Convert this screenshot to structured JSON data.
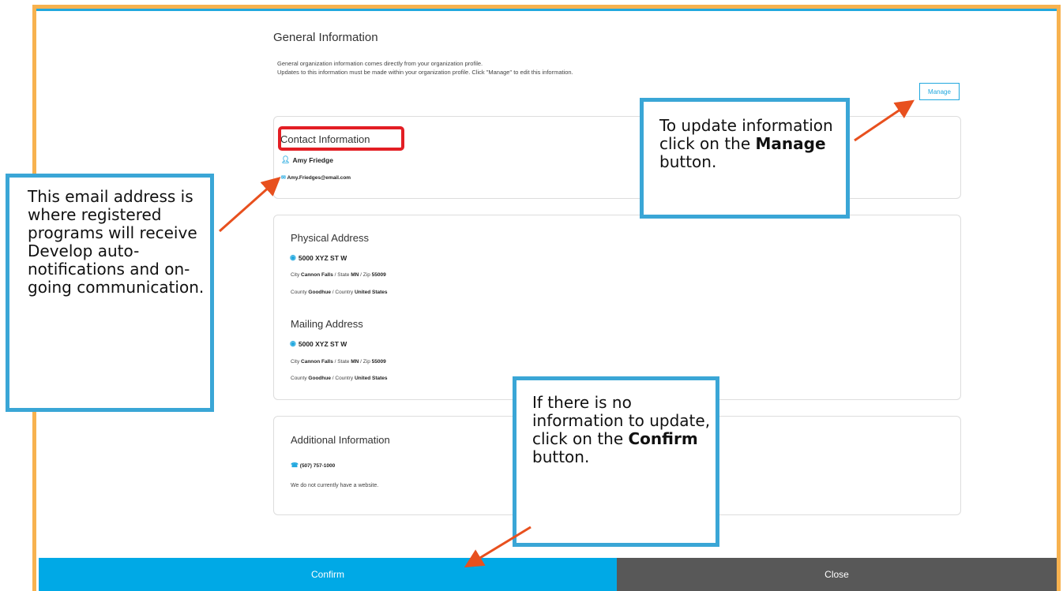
{
  "general": {
    "title": "General Information",
    "description_line1": "General organization information comes directly from your organization profile.",
    "description_line2": "Updates to this information must be made within your organization profile. Click \"Manage\" to edit this information.",
    "manage_label": "Manage"
  },
  "contact": {
    "heading": "Contact Information",
    "name": "Amy Friedge",
    "email": "Amy.Friedges@email.com",
    "icons": {
      "person": "person-icon",
      "email": "envelope-icon"
    }
  },
  "physical": {
    "heading": "Physical Address",
    "street": "5000 XYZ ST W",
    "city_label": "City",
    "city": "Cannon Falls",
    "state_label": "State",
    "state": "MN",
    "zip_label": "Zip",
    "zip": "55009",
    "county_label": "County",
    "county": "Goodhue",
    "country_label": "Country",
    "country": "United States"
  },
  "mailing": {
    "heading": "Mailing Address",
    "street": "5000 XYZ ST W",
    "city_label": "City",
    "city": "Cannon Falls",
    "state_label": "State",
    "state": "MN",
    "zip_label": "Zip",
    "zip": "55009",
    "county_label": "County",
    "county": "Goodhue",
    "country_label": "Country",
    "country": "United States"
  },
  "additional": {
    "heading": "Additional Information",
    "phone": "(507) 757-1000",
    "website_note": "We do not currently have a website."
  },
  "callouts": {
    "email_note": "This email address is where registered programs will receive Develop auto-notifications and on-going communication.",
    "manage_pre": "To update information click on the ",
    "manage_bold": "Manage",
    "manage_post": " button.",
    "confirm_pre": "If there is no information to update, click on the ",
    "confirm_bold": "Confirm",
    "confirm_post": " button."
  },
  "footer": {
    "confirm_label": "Confirm",
    "close_label": "Close"
  },
  "colors": {
    "frame": "#f7b24f",
    "accent": "#21a8df",
    "callout_border": "#3aa6d6",
    "highlight": "#e31e24",
    "arrow": "#e8501e",
    "confirm_bg": "#00a9e6",
    "close_bg": "#585858"
  }
}
